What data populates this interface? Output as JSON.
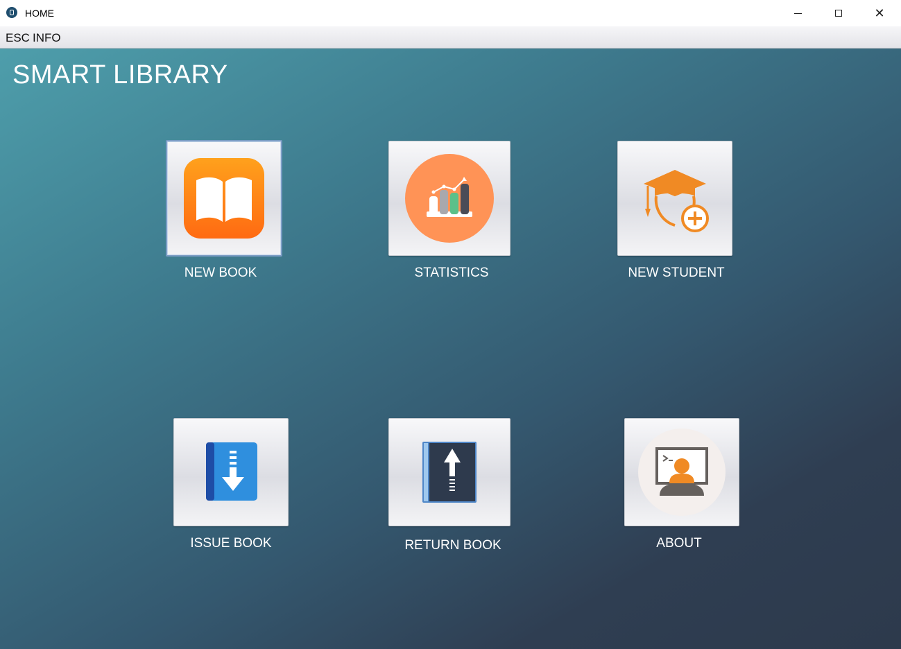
{
  "window": {
    "title": "HOME",
    "app_icon": "library-app-icon",
    "controls": {
      "minimize": "minimize-icon",
      "maximize": "maximize-icon",
      "close": "✕"
    }
  },
  "menubar": {
    "items": [
      "ESC",
      "INFO"
    ]
  },
  "main": {
    "title": "SMART LIBRARY",
    "tiles": [
      {
        "label": "NEW BOOK",
        "icon": "open-book-icon"
      },
      {
        "label": "STATISTICS",
        "icon": "bar-chart-icon"
      },
      {
        "label": "NEW STUDENT",
        "icon": "graduate-add-icon"
      },
      {
        "label": "ISSUE BOOK",
        "icon": "book-download-icon"
      },
      {
        "label": "RETURN BOOK",
        "icon": "book-upload-icon"
      },
      {
        "label": "ABOUT",
        "icon": "developer-terminal-icon"
      }
    ]
  },
  "colors": {
    "background_top": "#4e9eab",
    "background_bottom": "#2d3a4c",
    "accent_orange": "#f08a24",
    "stats_circle": "#ff9356",
    "issue_blue": "#2f8fde",
    "return_navy": "#2e3a4d"
  }
}
